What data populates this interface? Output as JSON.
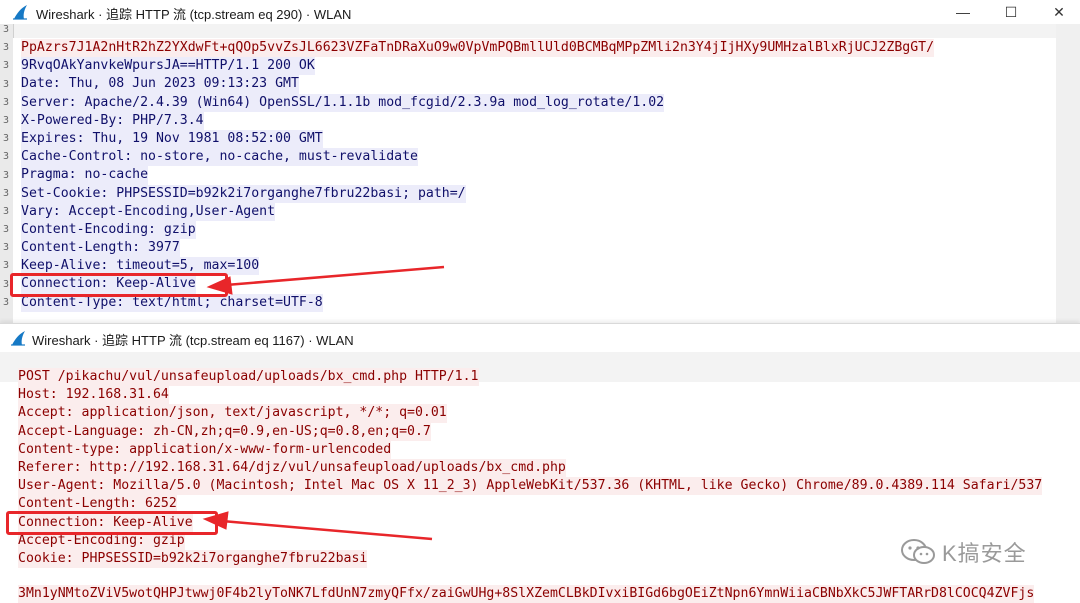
{
  "window1": {
    "title": "Wireshark · 追踪 HTTP 流 (tcp.stream eq 290) · WLAN",
    "controls": {
      "minimize": "—",
      "maximize": "☐",
      "close": "✕"
    },
    "request_tail": "PpAzrs7J1A2nHtR2hZ2YXdwFt+qQOp5vvZsJL6623VZFaTnDRaXuO9w0VpVmPQBmllUld0BCMBqMPpZMli2n3Y4jIjHXy9UMHzalBlxRjUCJ2ZBgGT/",
    "response_lines": [
      "9RvqOAkYanvkeWpursJA==HTTP/1.1 200 OK",
      "Date: Thu, 08 Jun 2023 09:13:23 GMT",
      "Server: Apache/2.4.39 (Win64) OpenSSL/1.1.1b mod_fcgid/2.3.9a mod_log_rotate/1.02",
      "X-Powered-By: PHP/7.3.4",
      "Expires: Thu, 19 Nov 1981 08:52:00 GMT",
      "Cache-Control: no-store, no-cache, must-revalidate",
      "Pragma: no-cache",
      "Set-Cookie: PHPSESSID=b92k2i7organghe7fbru22basi; path=/",
      "Vary: Accept-Encoding,User-Agent",
      "Content-Encoding: gzip",
      "Content-Length: 3977",
      "Keep-Alive: timeout=5, max=100",
      "Connection: Keep-Alive",
      "Content-Type: text/html; charset=UTF-8"
    ]
  },
  "window2": {
    "title": "Wireshark · 追踪 HTTP 流 (tcp.stream eq 1167) · WLAN",
    "request_lines": [
      "POST /pikachu/vul/unsafeupload/uploads/bx_cmd.php HTTP/1.1",
      "Host: 192.168.31.64",
      "Accept: application/json, text/javascript, */*; q=0.01",
      "Accept-Language: zh-CN,zh;q=0.9,en-US;q=0.8,en;q=0.7",
      "Content-type: application/x-www-form-urlencoded",
      "Referer: http://192.168.31.64/djz/vul/unsafeupload/uploads/bx_cmd.php",
      "User-Agent: Mozilla/5.0 (Macintosh; Intel Mac OS X 11_2_3) AppleWebKit/537.36 (KHTML, like Gecko) Chrome/89.0.4389.114 Safari/537",
      "Content-Length: 6252",
      "Connection: Keep-Alive",
      "Accept-Encoding: gzip",
      "Cookie: PHPSESSID=b92k2i7organghe7fbru22basi"
    ],
    "body_line": "3Mn1yNMtoZViV5wotQHPJtwwj0F4b2lyToNK7LfdUnN7zmyQFfx/zaiGwUHg+8SlXZemCLBkDIvxiBIGd6bgOEiZtNpn6YmnWiiaCBNbXkC5JWFTARrD8lCOCQ4ZVFjs"
  },
  "watermark": {
    "text": "K搞安全"
  },
  "colors": {
    "annotation": "#e8262a",
    "request_text": "#8b0000",
    "request_bg": "#fbeded",
    "response_text": "#10106a",
    "response_bg": "#ececfa"
  }
}
